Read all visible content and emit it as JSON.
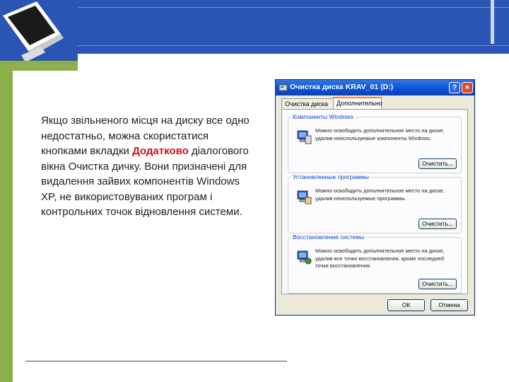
{
  "slide": {
    "text_before": "Якщо  звільненого місця на диску все одно недостатньо,  можна скористатися кнопками вкладки ",
    "text_highlight": "Додатково",
    "text_after": " діалогового вікна Очистка дичку. Вони призначені для видалення зайвих компонентів Windows XP, не використовуваних програм і контрольних точок відновлення системи.",
    "colors": {
      "band": "#2a55b5",
      "accent_bar": "#8db04c",
      "highlight": "#c0161e"
    }
  },
  "dialog": {
    "title": "Очистка диска KRAV_01 (D:)",
    "help_label": "?",
    "close_label": "×",
    "tabs": [
      "Очистка диска",
      "Дополнительно"
    ],
    "groups": [
      {
        "title": "Компоненты Windows",
        "desc": "Можно освободить дополнительное место на диске, удалив неиспользуемые компоненты Windows.",
        "button": "Очистить..."
      },
      {
        "title": "Установленные программы",
        "desc": "Можно освободить дополнительное место на диске, удалив неиспользуемые программы.",
        "button": "Очистить..."
      },
      {
        "title": "Восстановление системы",
        "desc": "Можно освободить дополнительное место на диске, удалив все точки восстановления, кроме последней точки восстановления",
        "button": "Очистить..."
      }
    ],
    "ok_label": "ОК",
    "cancel_label": "Отмена"
  }
}
